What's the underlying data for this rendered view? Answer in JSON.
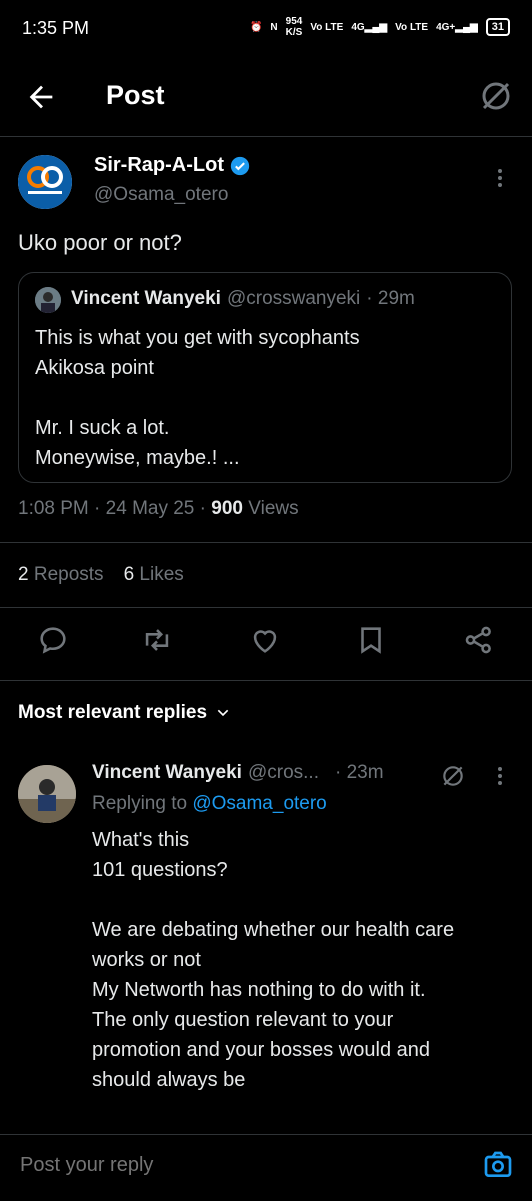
{
  "status_bar": {
    "time": "1:35 PM",
    "speed": "954",
    "speed_unit": "K/S",
    "net1": "Vo LTE",
    "net2": "4G",
    "net3": "Vo LTE",
    "net4": "4G+",
    "battery": "31"
  },
  "header": {
    "title": "Post"
  },
  "post": {
    "author_name": "Sir-Rap-A-Lot",
    "author_handle": "@Osama_otero",
    "text": "Uko poor or not?",
    "time": "1:08 PM",
    "date": "24 May 25",
    "views_count": "900",
    "views_label": "Views",
    "reposts_count": "2",
    "reposts_label": "Reposts",
    "likes_count": "6",
    "likes_label": "Likes"
  },
  "quote": {
    "name": "Vincent Wanyeki",
    "handle": "@crosswanyeki",
    "age": "· 29m",
    "lines": [
      "This is what you get with sycophants",
      "Akikosa point",
      "",
      "Mr. I suck a lot.",
      "Moneywise, maybe.! ..."
    ]
  },
  "replies_sort": {
    "label": "Most relevant replies"
  },
  "reply": {
    "name": "Vincent Wanyeki",
    "handle": "@cros...",
    "age": "· 23m",
    "replying_prefix": "Replying to",
    "replying_handle": "@Osama_otero",
    "lines": [
      "What's this",
      "101 questions?",
      "",
      "We are debating whether our health care",
      "works or not",
      "My Networth has nothing to do with it.",
      "The only question relevant to your",
      "promotion and your bosses would and",
      "should always be"
    ]
  },
  "composer": {
    "placeholder": "Post your reply"
  },
  "colors": {
    "accent": "#1d9bf0",
    "muted": "#71767b",
    "border": "#2f3336",
    "background": "#000000"
  }
}
